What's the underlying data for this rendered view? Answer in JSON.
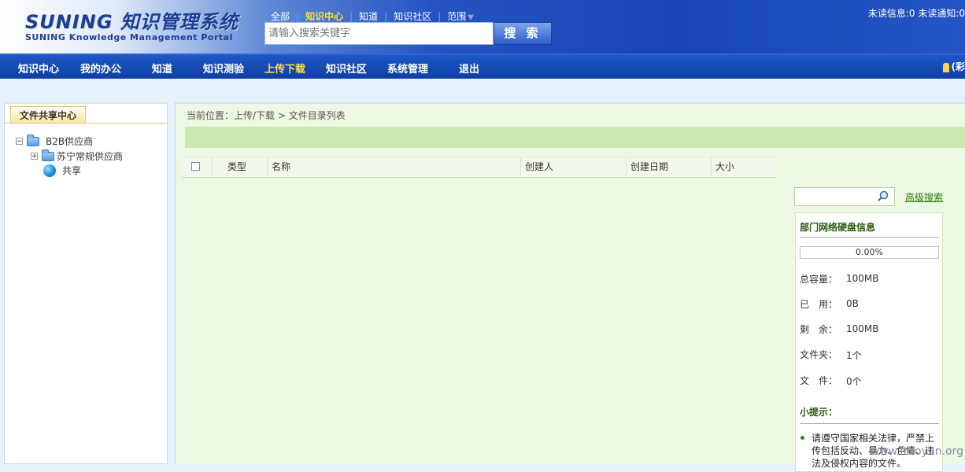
{
  "header": {
    "logo": "SUNING 知识管理系统",
    "logo_sub": "SUNING Knowledge Management Portal",
    "top_links": [
      "全部",
      "知识中心",
      "知道",
      "知识社区",
      "范围"
    ],
    "search_placeholder": "请输入搜索关键字",
    "search_button": "搜 索",
    "unread": "未读信息:0  未读通知:0"
  },
  "nav": {
    "items": [
      "知识中心",
      "我的办公",
      "知道",
      "知识测验",
      "上传下载",
      "知识社区",
      "系统管理",
      "退出"
    ],
    "active_index": 4,
    "right_text": "(彩"
  },
  "left": {
    "tab": "文件共享中心",
    "tree": [
      {
        "label": "B2B供应商",
        "sign": "−"
      },
      {
        "label": "苏宁常规供应商",
        "sign": "+"
      },
      {
        "label": "共享"
      }
    ]
  },
  "main": {
    "breadcrumb": "当前位置：上传/下载 > 文件目录列表",
    "table_headers": [
      "类型",
      "名称",
      "创建人",
      "创建日期",
      "大小"
    ]
  },
  "sidebar": {
    "advanced_search": "高级搜索",
    "disk_title": "部门网络硬盘信息",
    "usage_percent": "0.00%",
    "usage_fraction": 0,
    "info": [
      {
        "label": "总容量：",
        "value": "100MB"
      },
      {
        "label": "已　用：",
        "value": "0B"
      },
      {
        "label": "剩　余：",
        "value": "100MB"
      },
      {
        "label": "文件夹：",
        "value": "1个"
      },
      {
        "label": "文　件：",
        "value": "0个"
      }
    ],
    "tip_title": "小提示：",
    "tip_text": "请遵守国家相关法律，严禁上传包括反动、暴力、色情、违法及侵权内容的文件。"
  },
  "watermark": "www.ftooyun.org",
  "colors": {
    "accent": "#1846b6",
    "active_nav": "#ffe13a",
    "panel_green": "#ecf8e3"
  }
}
